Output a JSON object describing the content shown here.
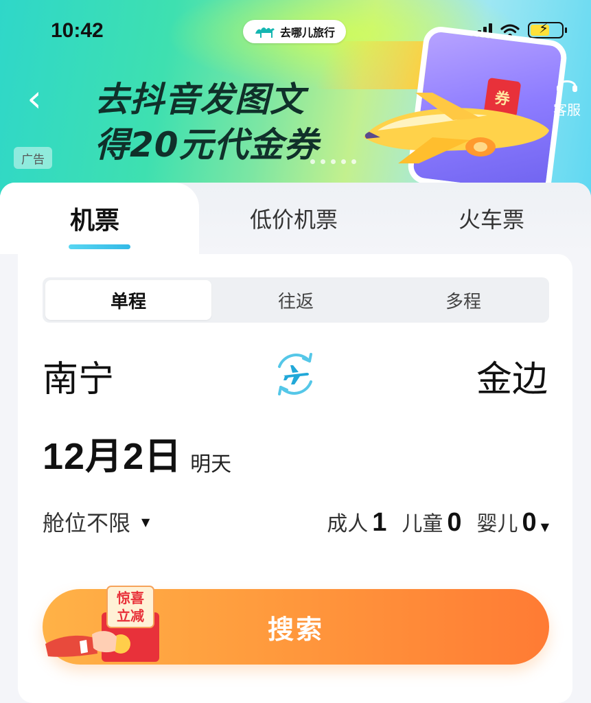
{
  "status_bar": {
    "time": "10:42",
    "app_name": "去哪儿旅行",
    "icons": [
      "signal-icon",
      "wifi-icon",
      "battery-charging-icon"
    ]
  },
  "banner": {
    "promo_line1": "去抖音发图文",
    "promo_line2": "得20元代金券",
    "ad_tag": "广告",
    "coupon_text": "券",
    "service_label": "客服",
    "colors": {
      "start": "#2fd7c9",
      "mid": "#c3f08e",
      "end": "#5fd8f2"
    }
  },
  "tabs": [
    {
      "label": "机票",
      "active": true
    },
    {
      "label": "低价机票",
      "active": false
    },
    {
      "label": "火车票",
      "active": false
    }
  ],
  "trip_types": [
    {
      "label": "单程",
      "active": true
    },
    {
      "label": "往返",
      "active": false
    },
    {
      "label": "多程",
      "active": false
    }
  ],
  "route": {
    "from": "南宁",
    "to": "金边"
  },
  "date": {
    "main": "12月2日",
    "sub": "明天"
  },
  "cabin": {
    "label": "舱位不限"
  },
  "passengers": {
    "adult_label": "成人",
    "adult_count": "1",
    "child_label": "儿童",
    "child_count": "0",
    "infant_label": "婴儿",
    "infant_count": "0"
  },
  "search": {
    "label": "搜索",
    "sticker_line1": "惊喜",
    "sticker_line2": "立减",
    "accent": "#ff8a3a"
  }
}
